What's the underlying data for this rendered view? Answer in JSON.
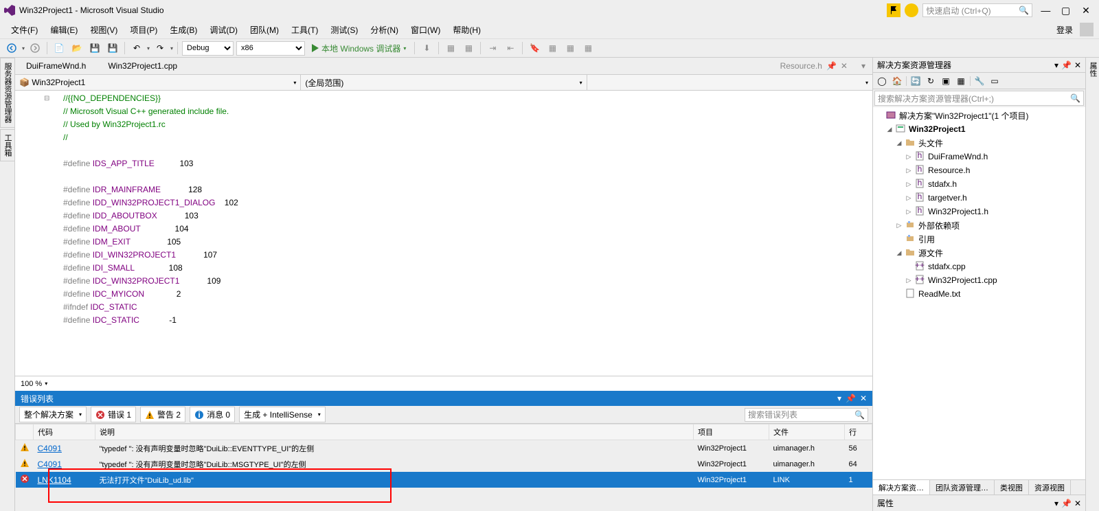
{
  "title": "Win32Project1 - Microsoft Visual Studio",
  "quicklaunch_placeholder": "快速启动 (Ctrl+Q)",
  "menu": [
    "文件(F)",
    "编辑(E)",
    "视图(V)",
    "项目(P)",
    "生成(B)",
    "调试(D)",
    "团队(M)",
    "工具(T)",
    "测试(S)",
    "分析(N)",
    "窗口(W)",
    "帮助(H)"
  ],
  "login": "登录",
  "toolbar": {
    "config": "Debug",
    "platform": "x86",
    "start_label": "本地 Windows 调试器"
  },
  "leftrail": [
    "服务器资源管理器",
    "工具箱"
  ],
  "rightrail": "属性",
  "tabs": {
    "open": [
      "DuiFrameWnd.h",
      "Win32Project1.cpp"
    ],
    "right_faded": "Resource.h"
  },
  "nav": {
    "scope": "Win32Project1",
    "member": "(全局范围)"
  },
  "code_lines": [
    "//{{NO_DEPENDENCIES}}",
    "// Microsoft Visual C++ generated include file.",
    "// Used by Win32Project1.rc",
    "//",
    "",
    "#define IDS_APP_TITLE           103",
    "",
    "#define IDR_MAINFRAME            128",
    "#define IDD_WIN32PROJECT1_DIALOG    102",
    "#define IDD_ABOUTBOX            103",
    "#define IDM_ABOUT               104",
    "#define IDM_EXIT                105",
    "#define IDI_WIN32PROJECT1            107",
    "#define IDI_SMALL               108",
    "#define IDC_WIN32PROJECT1            109",
    "#define IDC_MYICON              2",
    "#ifndef IDC_STATIC",
    "#define IDC_STATIC             -1"
  ],
  "zoom": "100 %",
  "error_panel": {
    "title": "错误列表",
    "scope": "整个解决方案",
    "buttons": {
      "errors": "错误 1",
      "warnings": "警告 2",
      "messages": "消息 0"
    },
    "build_combo": "生成 + IntelliSense",
    "search_placeholder": "搜索错误列表",
    "columns": [
      "",
      "代码",
      "说明",
      "项目",
      "文件",
      "行"
    ],
    "rows": [
      {
        "type": "warn",
        "code": "C4091",
        "desc": "\"typedef \": 没有声明变量时忽略\"DuiLib::EVENTTYPE_UI\"的左侧",
        "project": "Win32Project1",
        "file": "uimanager.h",
        "line": "56",
        "sel": false
      },
      {
        "type": "warn",
        "code": "C4091",
        "desc": "\"typedef \": 没有声明变量时忽略\"DuiLib::MSGTYPE_UI\"的左侧",
        "project": "Win32Project1",
        "file": "uimanager.h",
        "line": "64",
        "sel": false
      },
      {
        "type": "err",
        "code": "LNK1104",
        "desc": "无法打开文件\"DuiLib_ud.lib\"",
        "project": "Win32Project1",
        "file": "LINK",
        "line": "1",
        "sel": true
      }
    ]
  },
  "solution": {
    "panel_title": "解决方案资源管理器",
    "search_placeholder": "搜索解决方案资源管理器(Ctrl+;)",
    "root": "解决方案\"Win32Project1\"(1 个项目)",
    "project": "Win32Project1",
    "folders": {
      "headers": {
        "label": "头文件",
        "items": [
          "DuiFrameWnd.h",
          "Resource.h",
          "stdafx.h",
          "targetver.h",
          "Win32Project1.h"
        ]
      },
      "external": "外部依赖项",
      "refs": "引用",
      "sources": {
        "label": "源文件",
        "items": [
          "stdafx.cpp",
          "Win32Project1.cpp"
        ]
      },
      "readme": "ReadMe.txt"
    },
    "bottom_tabs": [
      "解决方案资…",
      "团队资源管理…",
      "类视图",
      "资源视图"
    ],
    "props_label": "属性"
  }
}
